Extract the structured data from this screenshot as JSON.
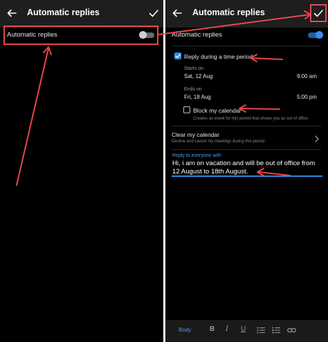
{
  "left": {
    "title": "Automatic replies",
    "toggle_label": "Automatic replies",
    "toggle_on": false
  },
  "right": {
    "title": "Automatic replies",
    "toggle_label": "Automatic replies",
    "toggle_on": true,
    "reply_period_label": "Reply during a time period",
    "starts_label": "Starts on",
    "start_date": "Sat, 12 Aug",
    "start_time": "9:00 am",
    "ends_label": "Ends on",
    "end_date": "Fri, 18 Aug",
    "end_time": "5:00 pm",
    "block_calendar_label": "Block my calendar",
    "block_calendar_desc": "Creates an event for this period that shows you as out of office",
    "clear_calendar_label": "Clear my calendar",
    "clear_calendar_desc": "Decline and cancel my meetings during this period",
    "reply_everyone_label": "Reply to everyone with",
    "reply_message": "Hi, i am on vacation and will be out of office from 12 August to 18th August.",
    "toolbar_body": "Body"
  },
  "colors": {
    "annotation": "#e8474a",
    "accent": "#2e8ae6"
  }
}
